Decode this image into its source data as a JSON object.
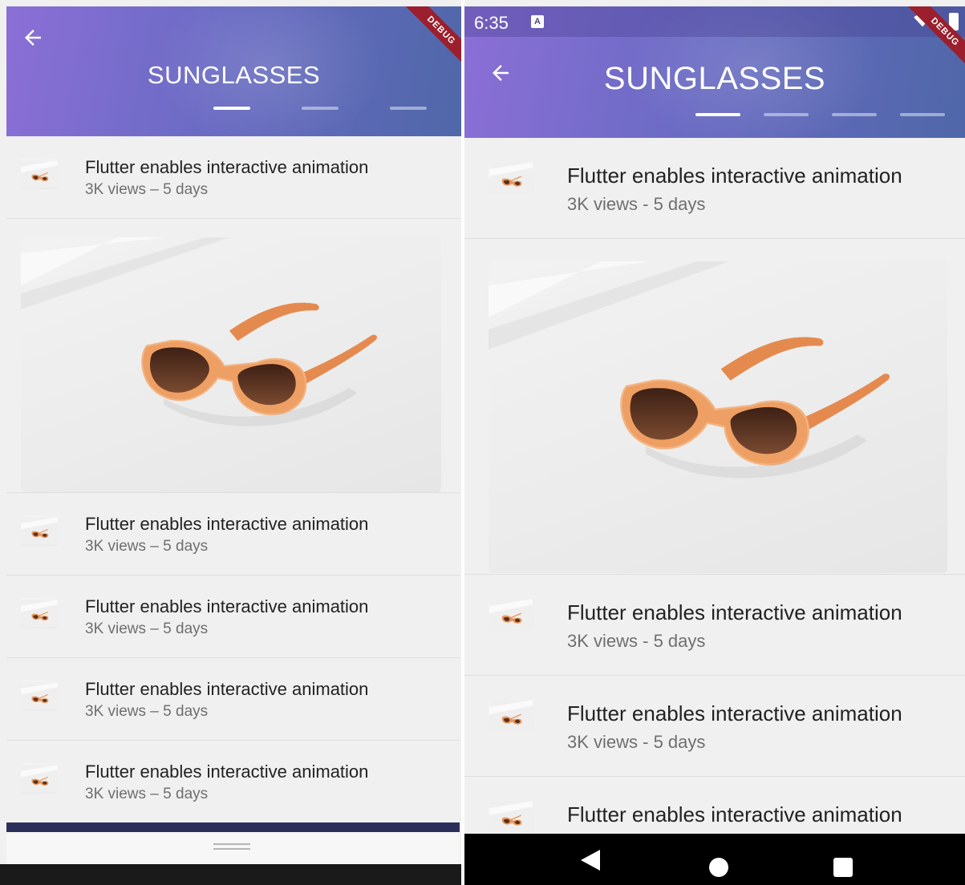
{
  "left_screen": {
    "header": {
      "title": "SUNGLASSES",
      "debug_label": "DEBUG"
    },
    "tab_indicators": [
      "active",
      "inactive",
      "inactive"
    ],
    "rows_top": [
      {
        "title": "Flutter enables interactive animation",
        "subtitle": "3K views – 5 days"
      }
    ],
    "rows_bottom": [
      {
        "title": "Flutter enables interactive animation",
        "subtitle": "3K views – 5 days"
      },
      {
        "title": "Flutter enables interactive animation",
        "subtitle": "3K views – 5 days"
      },
      {
        "title": "Flutter enables interactive animation",
        "subtitle": "3K views – 5 days"
      },
      {
        "title": "Flutter enables interactive animation",
        "subtitle": "3K views – 5 days"
      }
    ]
  },
  "right_screen": {
    "status_bar": {
      "time": "6:35",
      "notification_letter": "A"
    },
    "header": {
      "title": "SUNGLASSES",
      "debug_label": "DEBUG"
    },
    "tab_indicators": [
      "active",
      "inactive",
      "inactive",
      "inactive"
    ],
    "rows_top": [
      {
        "title": "Flutter enables interactive animation",
        "subtitle": "3K views - 5 days"
      }
    ],
    "rows_bottom": [
      {
        "title": "Flutter enables interactive animation",
        "subtitle": "3K views - 5 days"
      },
      {
        "title": "Flutter enables interactive animation",
        "subtitle": "3K views - 5 days"
      },
      {
        "title": "Flutter enables interactive animation",
        "subtitle": ""
      }
    ],
    "nav_icons": [
      "back-icon",
      "home-icon",
      "recents-icon"
    ]
  },
  "colors": {
    "header_gradient_start": "#8b6fd6",
    "header_gradient_end": "#4f67a8",
    "debug_banner": "#9b1f2c",
    "sunglasses_frame": "#e8955a",
    "sunglasses_lens": "#5a2f1c"
  }
}
